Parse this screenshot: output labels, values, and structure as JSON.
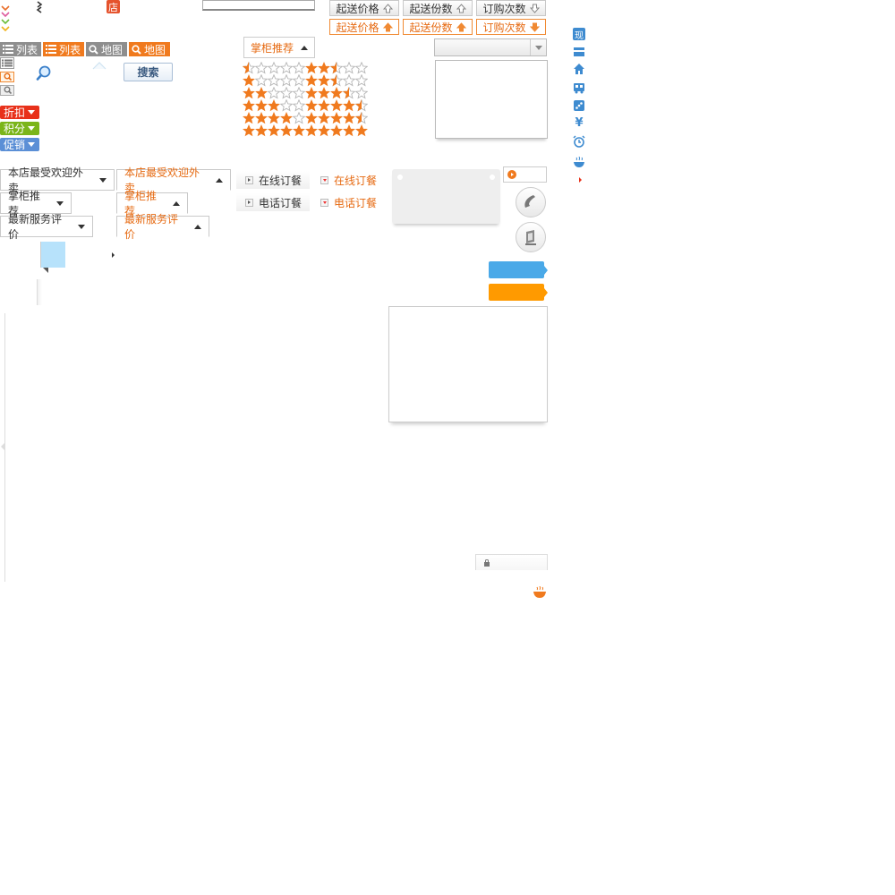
{
  "colors": {
    "orange": "#f07a1e",
    "grey": "#8e8e8e",
    "red": "#e8311a",
    "green": "#7bb51a",
    "blue": "#5b8fd6",
    "lightblue": "#4aa9e8",
    "amber": "#ff9a00",
    "icon_blue": "#3e8bd0"
  },
  "top": {
    "store_icon_label": "店"
  },
  "sort": {
    "row1": [
      {
        "label": "起送价格",
        "dir": "up"
      },
      {
        "label": "起送份数",
        "dir": "up"
      },
      {
        "label": "订购次数",
        "dir": "down"
      }
    ],
    "row2": [
      {
        "label": "起送价格",
        "dir": "up"
      },
      {
        "label": "起送份数",
        "dir": "up"
      },
      {
        "label": "订购次数",
        "dir": "down"
      }
    ]
  },
  "tabs": {
    "list_grey": "列表",
    "list_orange": "列表",
    "map_grey": "地图",
    "map_orange": "地图"
  },
  "search": {
    "button_label": "搜索"
  },
  "recommend": {
    "label": "掌柜推荐"
  },
  "ratings": {
    "group_a": [
      0.5,
      1,
      2,
      3,
      4,
      5
    ],
    "group_b": [
      2.5,
      2.5,
      3.5,
      4.5,
      4.5,
      5
    ]
  },
  "badges": [
    {
      "label": "折扣",
      "color": "#e8311a"
    },
    {
      "label": "积分",
      "color": "#7bb51a"
    },
    {
      "label": "促销",
      "color": "#5b8fd6"
    }
  ],
  "dropdowns": {
    "off": [
      "本店最受欢迎外卖",
      "掌柜推荐",
      "最新服务评价"
    ],
    "on": [
      "本店最受欢迎外卖",
      "掌柜推荐",
      "最新服务评价"
    ]
  },
  "order": {
    "online_off": "在线订餐",
    "phone_off": "电话订餐",
    "online_on": "在线订餐",
    "phone_on": "电话订餐"
  },
  "side_icons": [
    "现",
    "card-icon",
    "home-icon",
    "bus-icon",
    "dice-icon",
    "¥",
    "alarm-icon",
    "bowl-icon",
    "arrow-right-icon"
  ]
}
